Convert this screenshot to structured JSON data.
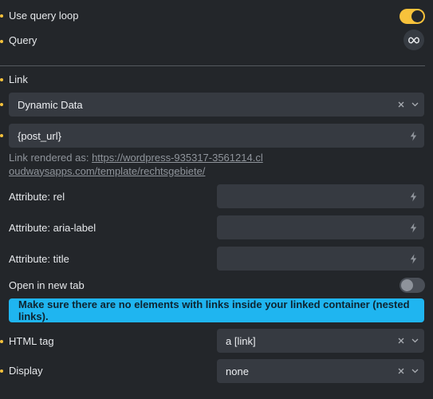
{
  "query_loop": {
    "label": "Use query loop",
    "enabled": true
  },
  "query": {
    "label": "Query",
    "icon": "infinity-icon"
  },
  "link": {
    "label": "Link",
    "type_value": "Dynamic Data",
    "url_value": "{post_url}",
    "rendered_prefix": "Link rendered as:",
    "rendered_url": "https://wordpress-935317-3561214.cloudwaysapps.com/template/rechtsgebiete/"
  },
  "attributes": [
    {
      "label": "Attribute: rel",
      "value": ""
    },
    {
      "label": "Attribute: aria-label",
      "value": ""
    },
    {
      "label": "Attribute: title",
      "value": ""
    }
  ],
  "new_tab": {
    "label": "Open in new tab",
    "enabled": false
  },
  "notice": "Make sure there are no elements with links inside your linked container (nested links).",
  "html_tag": {
    "label": "HTML tag",
    "value": "a [link]"
  },
  "display": {
    "label": "Display",
    "value": "none"
  },
  "colors": {
    "accent": "#f7c23b",
    "info": "#1fb5f0",
    "background": "#23262a",
    "field": "#363a41"
  }
}
